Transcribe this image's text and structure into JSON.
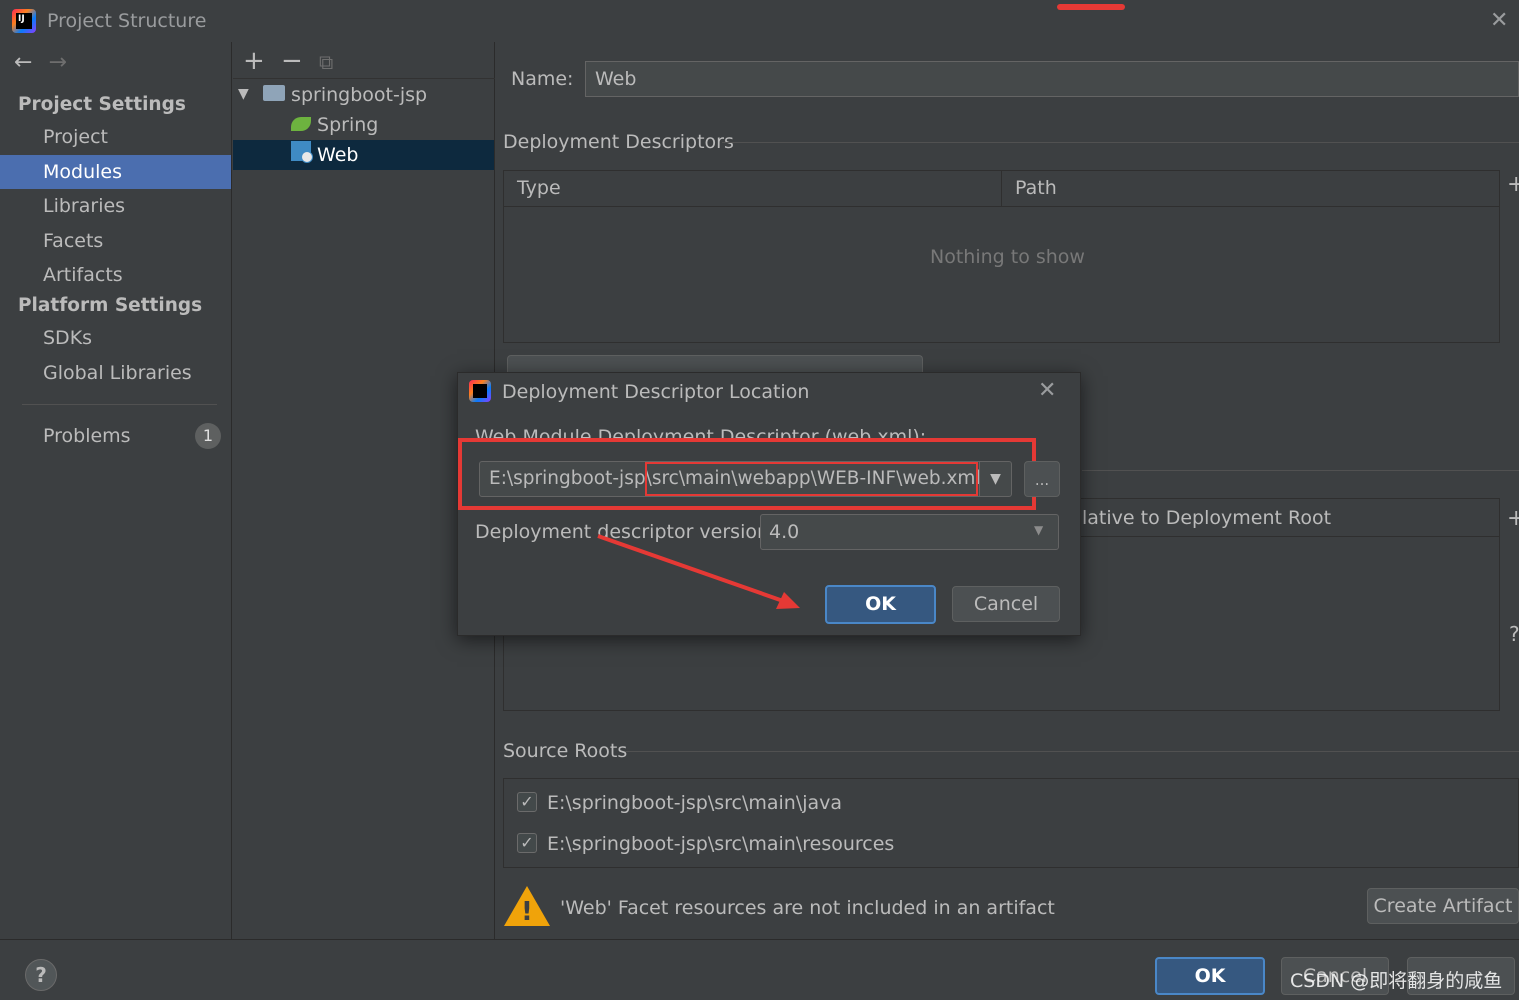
{
  "window": {
    "title": "Project Structure",
    "close_glyph": "✕",
    "logo_text": "IJ"
  },
  "nav": {
    "back_glyph": "←",
    "forward_glyph": "→",
    "project_settings_header": "Project Settings",
    "project_items": [
      "Project",
      "Modules",
      "Libraries",
      "Facets",
      "Artifacts"
    ],
    "selected_item": "Modules",
    "platform_settings_header": "Platform Settings",
    "platform_items": [
      "SDKs",
      "Global Libraries"
    ],
    "problems_label": "Problems",
    "problems_count": "1"
  },
  "tree": {
    "toolbar": {
      "add": "+",
      "remove": "−",
      "copy": "⧉"
    },
    "root": "springboot-jsp",
    "children": [
      "Spring",
      "Web"
    ],
    "selected": "Web"
  },
  "facet": {
    "name_label": "Name:",
    "name_value": "Web",
    "deployment_descriptors_title": "Deployment Descriptors",
    "table_columns": [
      "Type",
      "Path"
    ],
    "empty_text": "Nothing to show",
    "web_resource_column_partial": "lative to Deployment Root",
    "source_roots_title": "Source Roots",
    "source_roots": [
      {
        "checked": true,
        "path": "E:\\springboot-jsp\\src\\main\\java"
      },
      {
        "checked": true,
        "path": "E:\\springboot-jsp\\src\\main\\resources"
      }
    ],
    "warning_text": "'Web' Facet resources are not included in an artifact",
    "create_artifact_label": "Create Artifact"
  },
  "dialog": {
    "title": "Deployment Descriptor Location",
    "close_glyph": "✕",
    "descriptor_label": "Web Module Deployment Descriptor (web.xml):",
    "descriptor_value": "E:\\springboot-jsp\\src\\main\\webapp\\WEB-INF\\web.xml",
    "browse_label": "...",
    "version_label": "Deployment descriptor version",
    "version_value": "4.0",
    "ok_label": "OK",
    "cancel_label": "Cancel"
  },
  "bottom": {
    "help_label": "?",
    "ok_label": "OK",
    "cancel_label": "Cancel",
    "watermark": "CSDN @即将翻身的咸鱼"
  },
  "colors": {
    "background": "#3c3f41",
    "selection": "#4b6eaf",
    "tree_selection": "#0d293e",
    "primary_button": "#365880",
    "annotation_red": "#e53935",
    "warning": "#f0a30a"
  }
}
